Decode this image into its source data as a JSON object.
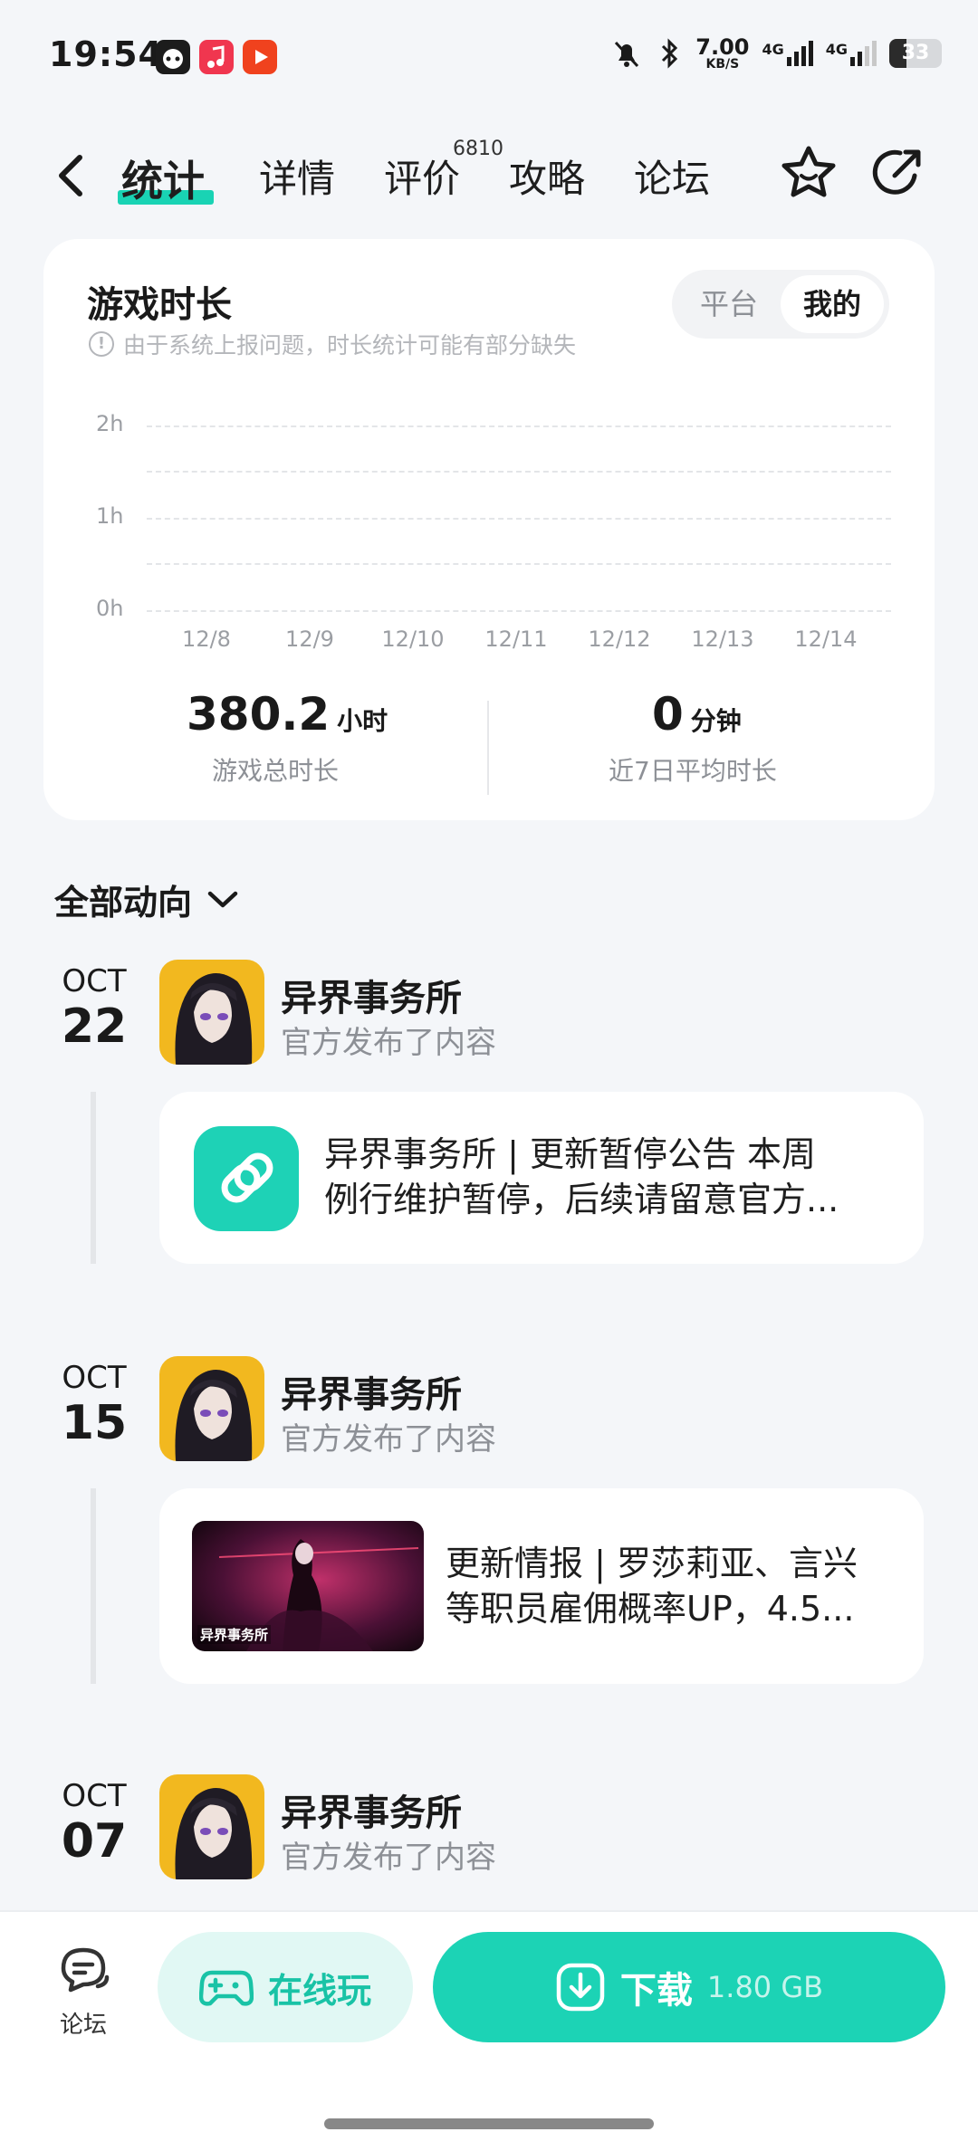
{
  "status_bar": {
    "time": "19:54",
    "net_speed": "7.00",
    "net_unit": "KB/S",
    "signal_1": "4G",
    "signal_2": "4G",
    "battery": "33",
    "battery_level": 0.33,
    "icons": [
      "game-controller-icon",
      "music-app-icon",
      "video-app-icon",
      "mute-bell-icon",
      "bluetooth-icon",
      "signal-icon",
      "signal-icon",
      "battery-icon"
    ]
  },
  "nav": {
    "tabs": [
      {
        "label": "统计",
        "active": true
      },
      {
        "label": "详情"
      },
      {
        "label": "评价"
      },
      {
        "label": "攻略"
      },
      {
        "label": "论坛"
      }
    ],
    "review_count": "6810",
    "icons": [
      "back-arrow-icon",
      "star-face-icon",
      "share-icon"
    ]
  },
  "stats": {
    "title": "游戏时长",
    "notice": "由于系统上报问题，时长统计可能有部分缺失",
    "toggle": [
      "平台",
      "我的"
    ],
    "toggle_selected": "我的",
    "total_value": "380.2",
    "total_unit": "小时",
    "total_label": "游戏总时长",
    "avg_value": "0",
    "avg_unit": "分钟",
    "avg_label": "近7日平均时长"
  },
  "chart_data": {
    "type": "bar",
    "categories": [
      "12/8",
      "12/9",
      "12/10",
      "12/11",
      "12/12",
      "12/13",
      "12/14"
    ],
    "values": [
      0,
      0,
      0,
      0,
      0,
      0,
      0
    ],
    "y_ticks": [
      "2h",
      "1h",
      "0h"
    ],
    "ylim": [
      0,
      2
    ],
    "grid": true
  },
  "feed": {
    "filter_label": "全部动向",
    "items": [
      {
        "month": "OCT",
        "day": "22",
        "publisher": "异界事务所",
        "action": "官方发布了内容",
        "post_line1": "异界事务所 | 更新暂停公告 本周",
        "post_line2": "例行维护暂停，后续请留意官方...",
        "media": "link-icon"
      },
      {
        "month": "OCT",
        "day": "15",
        "publisher": "异界事务所",
        "action": "官方发布了内容",
        "post_line1": "更新情报 | 罗莎莉亚、言兴",
        "post_line2": "等职员雇佣概率UP，4.5...",
        "media": "thumbnail",
        "thumb_logo": "异界事务所"
      },
      {
        "month": "OCT",
        "day": "07",
        "publisher": "异界事务所",
        "action": "官方发布了内容"
      }
    ]
  },
  "bottom_bar": {
    "forum_label": "论坛",
    "play_label": "在线玩",
    "download_label": "下载",
    "download_size": "1.80 GB"
  },
  "colors": {
    "accent": "#1cd3b5",
    "accent_light": "#e1f8f4",
    "background": "#f4f6f9"
  }
}
